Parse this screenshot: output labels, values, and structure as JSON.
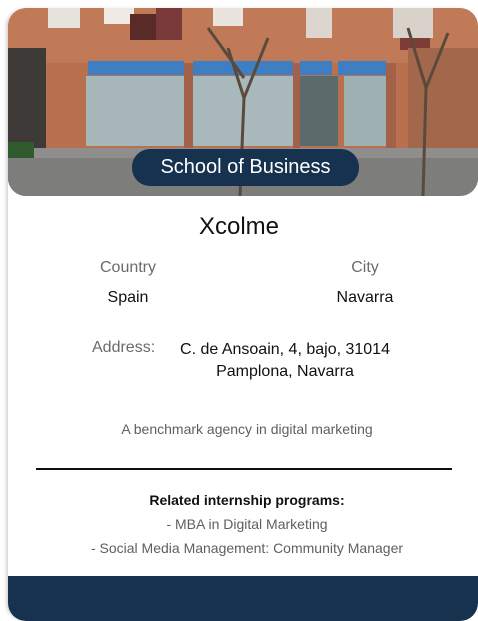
{
  "card": {
    "badge": "School of Business",
    "name": "Xcolme",
    "country_label": "Country",
    "country_value": "Spain",
    "city_label": "City",
    "city_value": "Navarra",
    "address_label": "Address:",
    "address_line1": "C. de Ansoain, 4, bajo, 31014",
    "address_line2": "Pamplona, Navarra",
    "description": "A benchmark agency in digital marketing",
    "related_title": "Related internship programs:",
    "programs": [
      "- MBA in Digital Marketing",
      "- Social Media Management: Community Manager"
    ]
  },
  "colors": {
    "navy": "#16324f",
    "brick": "#b56a48"
  }
}
